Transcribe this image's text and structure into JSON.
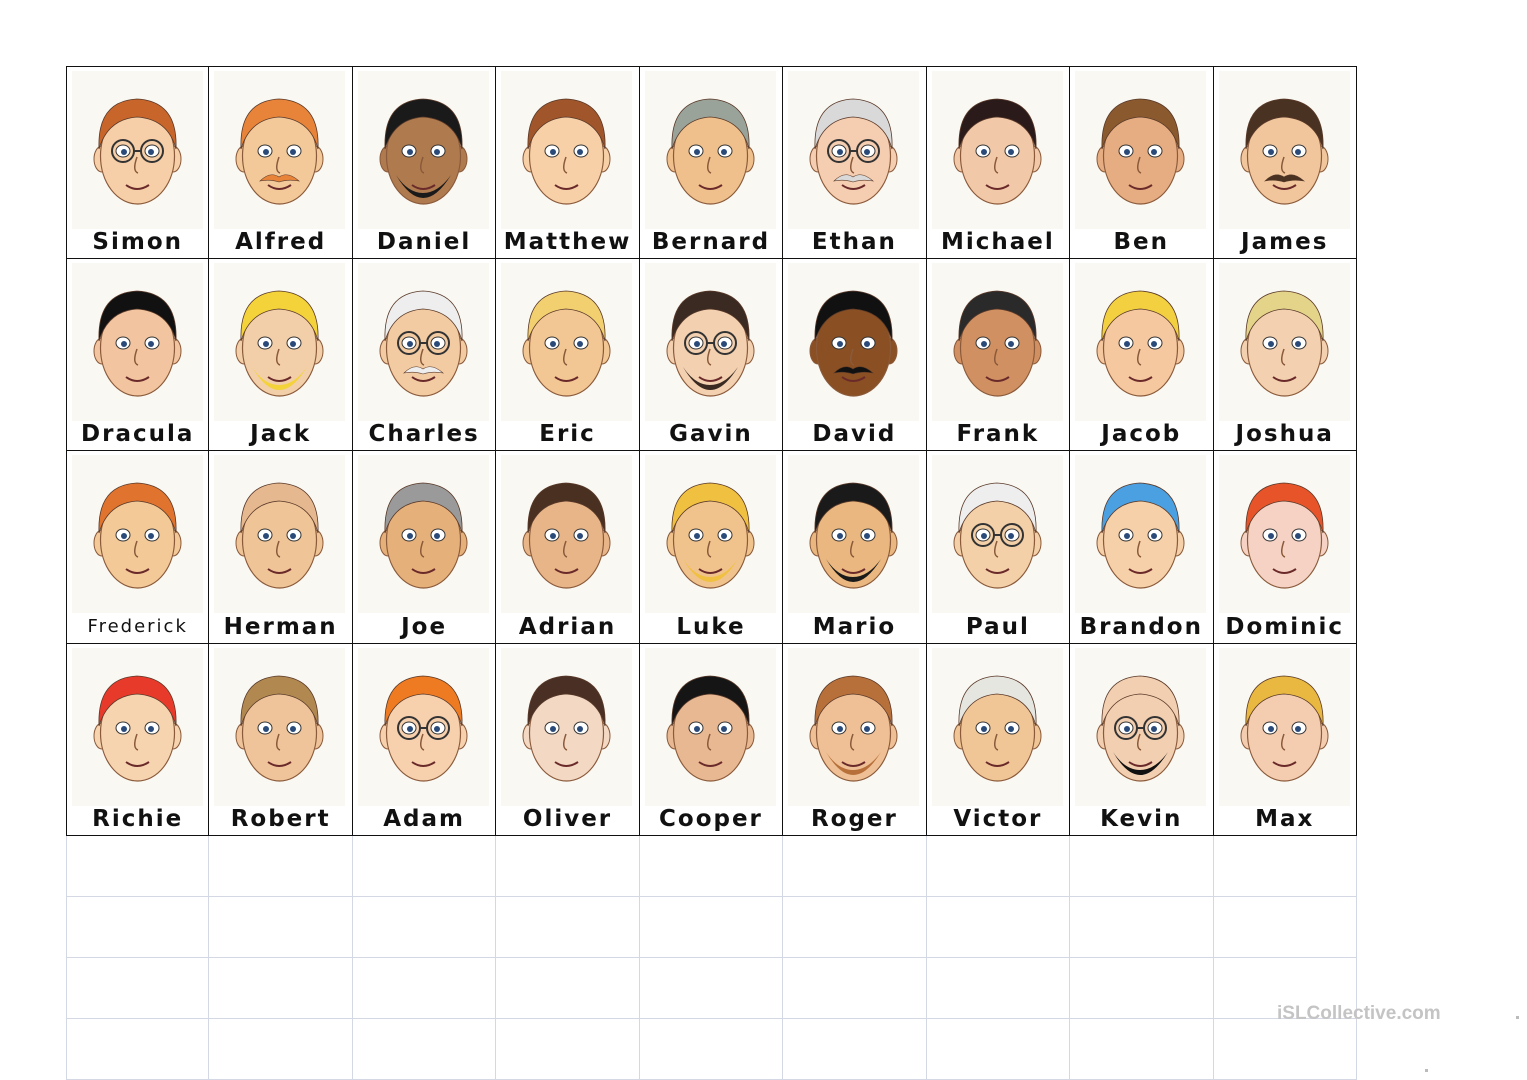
{
  "worksheet": {
    "characters": [
      {
        "name": "Simon",
        "skin": "#f6cfa8",
        "hair": "#c8652a",
        "glasses": true
      },
      {
        "name": "Alfred",
        "skin": "#f3c99a",
        "hair": "#e8843a",
        "mustache": true
      },
      {
        "name": "Daniel",
        "skin": "#b07a4f",
        "hair": "#1a1a1a",
        "beard": true
      },
      {
        "name": "Matthew",
        "skin": "#f7d0a8",
        "hair": "#a0562a"
      },
      {
        "name": "Bernard",
        "skin": "#efc08c",
        "hair": "#9aa39a"
      },
      {
        "name": "Ethan",
        "skin": "#f5cdb0",
        "hair": "#d9d9d9",
        "glasses": true,
        "mustache": true
      },
      {
        "name": "Michael",
        "skin": "#f2c9a8",
        "hair": "#2a1a1a"
      },
      {
        "name": "Ben",
        "skin": "#e6ad82",
        "hair": "#8a5a2e"
      },
      {
        "name": "James",
        "skin": "#f1c69c",
        "hair": "#4a3222",
        "mustache": true
      },
      {
        "name": "Dracula",
        "skin": "#f2c5a0",
        "hair": "#111111"
      },
      {
        "name": "Jack",
        "skin": "#f2cfa8",
        "hair": "#f3d23a",
        "beard": true
      },
      {
        "name": "Charles",
        "skin": "#f3cba2",
        "hair": "#eeeeee",
        "glasses": true,
        "mustache": true
      },
      {
        "name": "Eric",
        "skin": "#f3c794",
        "hair": "#f2d070"
      },
      {
        "name": "Gavin",
        "skin": "#f3d0b0",
        "hair": "#3a2a22",
        "beard": true,
        "glasses": true
      },
      {
        "name": "David",
        "skin": "#8a4f22",
        "hair": "#111111",
        "mustache": true
      },
      {
        "name": "Frank",
        "skin": "#d09062",
        "hair": "#2a2a2a"
      },
      {
        "name": "Jacob",
        "skin": "#f5c8a0",
        "hair": "#f2d040"
      },
      {
        "name": "Joshua",
        "skin": "#f3d0b0",
        "hair": "#e3d48a"
      },
      {
        "name": "Frederick",
        "skin": "#f3c998",
        "hair": "#e0742e"
      },
      {
        "name": "Herman",
        "skin": "#efc497",
        "hair": "#e6b890"
      },
      {
        "name": "Joe",
        "skin": "#e6b07a",
        "hair": "#9a9a9a"
      },
      {
        "name": "Adrian",
        "skin": "#e8b588",
        "hair": "#4a3020"
      },
      {
        "name": "Luke",
        "skin": "#f1c38c",
        "hair": "#f0c040",
        "beard": true
      },
      {
        "name": "Mario",
        "skin": "#e9b77f",
        "hair": "#1a1a1a",
        "beard": true
      },
      {
        "name": "Paul",
        "skin": "#f3d0a8",
        "hair": "#eeeeee",
        "glasses": true
      },
      {
        "name": "Brandon",
        "skin": "#f6d0a8",
        "hair": "#4aa0e0"
      },
      {
        "name": "Dominic",
        "skin": "#f5d2c4",
        "hair": "#e8542a"
      },
      {
        "name": "Richie",
        "skin": "#f7d4b0",
        "hair": "#e83a2a"
      },
      {
        "name": "Robert",
        "skin": "#efc49a",
        "hair": "#b08850"
      },
      {
        "name": "Adam",
        "skin": "#f7d0ae",
        "hair": "#ee7a22",
        "glasses": true
      },
      {
        "name": "Oliver",
        "skin": "#f3d8c4",
        "hair": "#4a3024"
      },
      {
        "name": "Cooper",
        "skin": "#e8b892",
        "hair": "#151515"
      },
      {
        "name": "Roger",
        "skin": "#efc095",
        "hair": "#b8703a",
        "beard": true
      },
      {
        "name": "Victor",
        "skin": "#f1c697",
        "hair": "#e6e6e0"
      },
      {
        "name": "Kevin",
        "skin": "#f2cfb0",
        "hair": "#f2cfb0",
        "beard": true,
        "glasses": true
      },
      {
        "name": "Max",
        "skin": "#f4cdb0",
        "hair": "#e8b840"
      }
    ]
  },
  "watermark": "iSLCollective.com"
}
